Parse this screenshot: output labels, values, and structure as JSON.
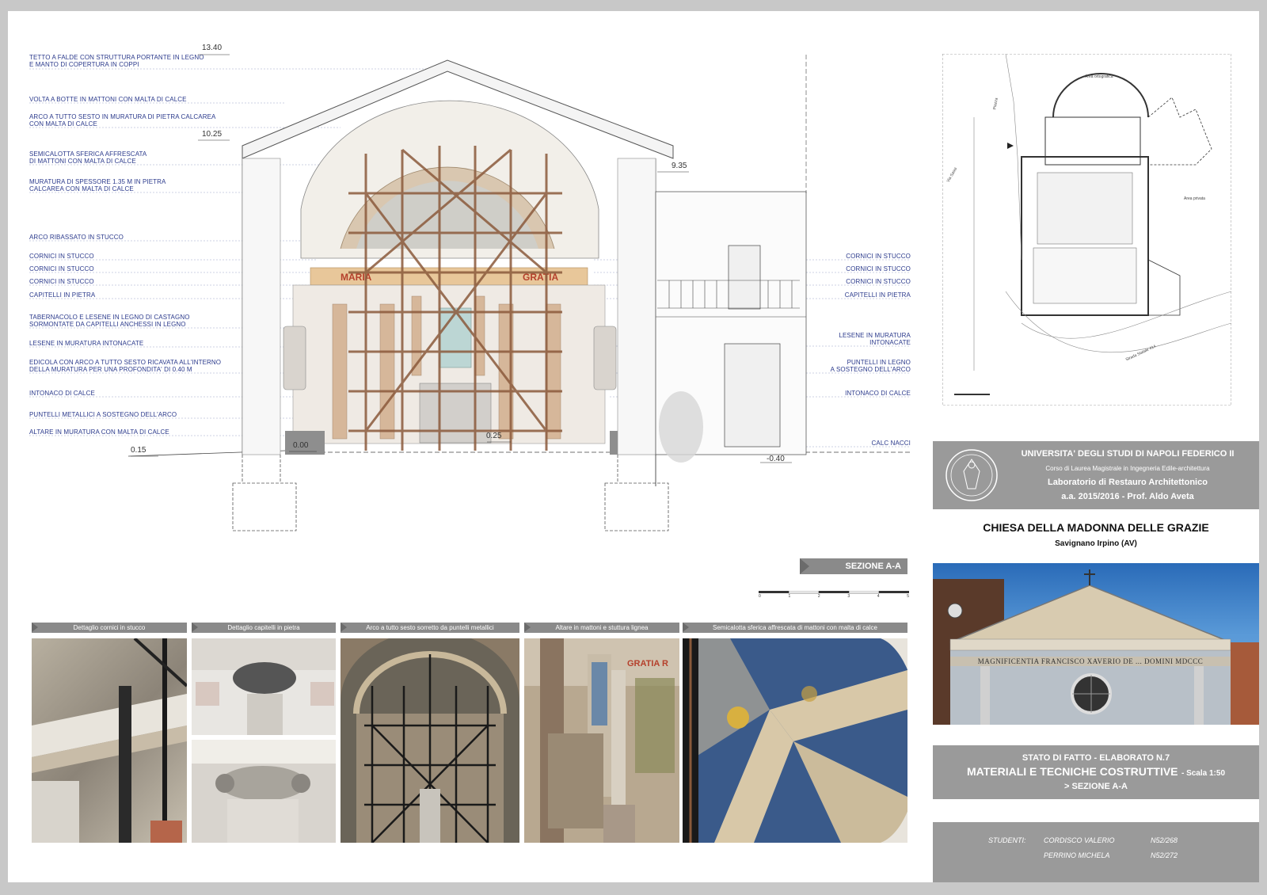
{
  "annotations_left": [
    "TETTO A FALDE CON STRUTTURA PORTANTE IN LEGNO",
    "E MANTO DI COPERTURA IN COPPI",
    "VOLTA A BOTTE IN MATTONI CON MALTA DI CALCE",
    "ARCO A TUTTO SESTO IN MURATURA DI PIETRA CALCAREA",
    "CON MALTA DI CALCE",
    "SEMICALOTTA SFERICA AFFRESCATA",
    "DI MATTONI CON MALTA DI CALCE",
    "MURATURA DI SPESSORE 1.35 m IN PIETRA",
    "CALCAREA CON MALTA DI CALCE",
    "ARCO RIBASSATO IN STUCCO",
    "CORNICI IN STUCCO",
    "CORNICI IN STUCCO",
    "CORNICI IN STUCCO",
    "CAPITELLI IN PIETRA",
    "TABERNACOLO E LESENE IN LEGNO DI CASTAGNO",
    "SORMONTATE DA CAPITELLI ANCHESSI IN LEGNO",
    "LESENE IN MURATURA INTONACATE",
    "EDICOLA CON ARCO A TUTTO SESTO RICAVATA ALL'INTERNO",
    "DELLA MURATURA PER UNA PROFONDITA' DI 0.40 m",
    "INTONACO DI CALCE",
    "PUNTELLI METALLICI A SOSTEGNO DELL'ARCO",
    "ALTARE IN MURATURA CON MALTA DI CALCE"
  ],
  "annotations_right": [
    "CORNICI IN STUCCO",
    "CORNICI IN STUCCO",
    "CORNICI IN STUCCO",
    "CAPITELLI IN PIETRA",
    "LESENE IN MURATURA",
    "INTONACATE",
    "PUNTELLI IN LEGNO",
    "A SOSTEGNO DELL'ARCO",
    "INTONACO DI CALCE",
    "CALC NACCI"
  ],
  "elevations": {
    "e1340": "13.40",
    "e1025": "10.25",
    "e935": "9.35",
    "e015": "0.15",
    "e000": "0.00",
    "e025": "0.25",
    "em040": "-0.40"
  },
  "altar_words": {
    "left": "MARIA",
    "right": "GRATIA"
  },
  "plan_labels": {
    "top": "Area ortografica",
    "right": "Area privata",
    "left1": "Via Sassi",
    "left2": "Piazza",
    "bottom": "Strada Statale 414"
  },
  "university": {
    "name": "UNIVERSITA' DEGLI STUDI DI NAPOLI FEDERICO II",
    "course": "Corso di Laurea Magistrale in Ingegneria Edile-architettura",
    "lab": "Laboratorio di Restauro Architettonico",
    "year": "a.a. 2015/2016 - Prof. Aldo Aveta"
  },
  "project": {
    "title": "CHIESA DELLA MADONNA DELLE GRAZIE",
    "location": "Savignano Irpino (AV)"
  },
  "section_tag": "SEZIONE A-A",
  "photo_captions": [
    "Dettaglio cornici in stucco",
    "Dettaglio capitelli in pietra",
    "Arco a tutto sesto sorretto da puntelli metallici",
    "Altare in mattoni e stuttura lignea",
    "Semicalotta sferica affrescata di mattoni con malta di calce"
  ],
  "facade_inscription": "MAGNIFICENTIA FRANCISCO XAVERIO DE ... DOMINI MDCCC",
  "drawing_info": {
    "line1": "STATO DI FATTO - ELABORATO N.7",
    "line2": "MATERIALI E TECNICHE COSTRUTTIVE",
    "scale": "- Scala 1:50",
    "line3": "> SEZIONE A-A"
  },
  "students": {
    "label": "STUDENTI:",
    "names": [
      "CORDISCO VALERIO",
      "PERRINO MICHELA"
    ],
    "ids": [
      "N52/268",
      "N52/272"
    ]
  },
  "scale_bar": [
    "0",
    "1",
    "2",
    "3",
    "4",
    "5"
  ],
  "colors": {
    "label_blue": "#2b3a8c",
    "panel_grey": "#9a9a9a",
    "scaffold": "#8b5a3c",
    "altar_band": "#e8c79a"
  }
}
